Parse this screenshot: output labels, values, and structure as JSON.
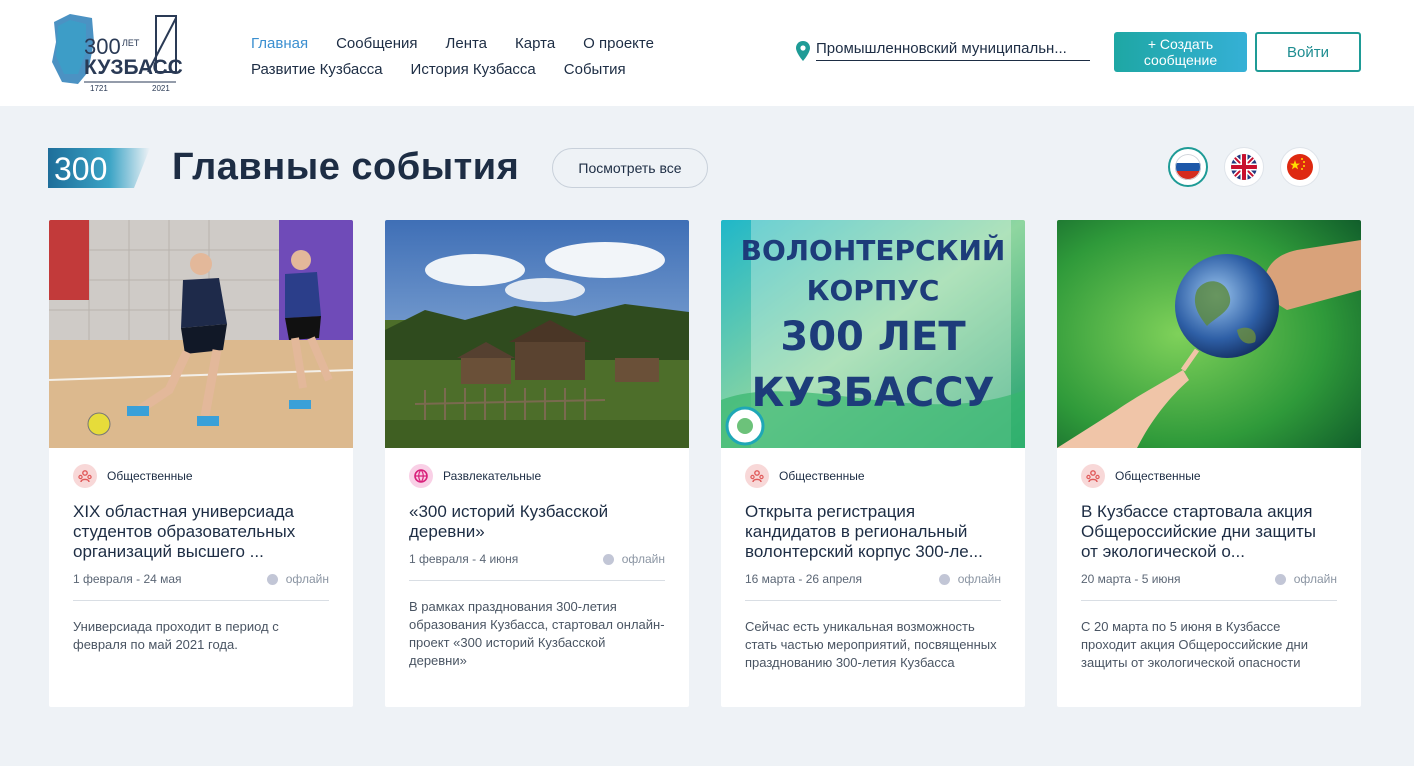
{
  "logo": {
    "top": "300",
    "years_word": "ЛЕТ",
    "name": "КУЗБАСС",
    "year_start": "1721",
    "year_end": "2021"
  },
  "nav": {
    "row1": [
      {
        "label": "Главная",
        "active": true
      },
      {
        "label": "Сообщения",
        "active": false
      },
      {
        "label": "Лента",
        "active": false
      },
      {
        "label": "Карта",
        "active": false
      },
      {
        "label": "О проекте",
        "active": false
      }
    ],
    "row2": [
      {
        "label": "Развитие Кузбасса",
        "active": false
      },
      {
        "label": "История Кузбасса",
        "active": false
      },
      {
        "label": "События",
        "active": false
      }
    ]
  },
  "location": {
    "text": "Промышленновский муниципальн..."
  },
  "header_buttons": {
    "create_line1": "+ Создать",
    "create_line2": "сообщение",
    "login": "Войти"
  },
  "section": {
    "badge": "300",
    "title": "Главные события",
    "view_all": "Посмотреть все"
  },
  "languages": [
    {
      "code": "ru",
      "icon": "russia-flag-icon",
      "active": true
    },
    {
      "code": "en",
      "icon": "uk-flag-icon",
      "active": false
    },
    {
      "code": "zh",
      "icon": "china-flag-icon",
      "active": false
    }
  ],
  "colors": {
    "accent": "#1e9b96",
    "active_nav": "#3b8fd0",
    "text": "#1d2d44",
    "background": "#eef2f6"
  },
  "cards": [
    {
      "category": "Общественные",
      "category_icon": "people-icon",
      "title": "XIX областная универсиада студентов образовательных организаций высшего ...",
      "dates": "1 февраля - 24 мая",
      "status": "офлайн",
      "description": "Универсиада проходит в период с февраля по май 2021 года."
    },
    {
      "category": "Развлекательные",
      "category_icon": "ball-icon",
      "title": "«300 историй Кузбасской деревни»",
      "dates": "1 февраля - 4 июня",
      "status": "офлайн",
      "description": "В рамках празднования 300-летия образования Кузбасса, стартовал онлайн-проект «300 историй Кузбасской деревни»"
    },
    {
      "category": "Общественные",
      "category_icon": "people-icon",
      "title": "Открыта регистрация кандидатов в региональный волонтерский корпус 300-ле...",
      "dates": "16 марта - 26 апреля",
      "status": "офлайн",
      "description": "Сейчас есть уникальная возможность стать частью мероприятий, посвященных празднованию 300-летия Кузбасса",
      "image_text": [
        "ВОЛОНТЕРСКИЙ",
        "КОРПУС",
        "300 ЛЕТ",
        "КУЗБАССУ"
      ]
    },
    {
      "category": "Общественные",
      "category_icon": "people-icon",
      "title": "В Кузбассе стартовала акция Общероссийские дни защиты от экологической о...",
      "dates": "20 марта - 5 июня",
      "status": "офлайн",
      "description": "С 20 марта по 5 июня в Кузбассе проходит акция Общероссийские дни защиты от экологической опасности"
    }
  ]
}
